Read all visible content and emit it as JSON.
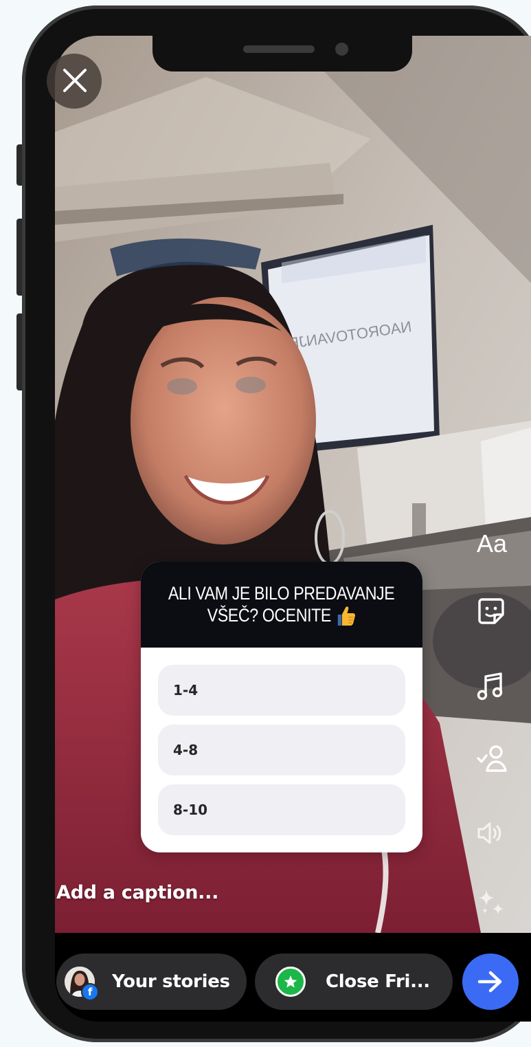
{
  "story_editor": {
    "close_icon": "close-icon",
    "tools": {
      "text_label": "Aa",
      "icons": [
        "sticker-icon",
        "music-note-icon",
        "tag-person-icon",
        "speaker-icon",
        "sparkles-icon"
      ]
    },
    "poll": {
      "question_line1": "ALI VAM JE BILO PREDAVANJE",
      "question_line2": "VŠEČ? OCENITE",
      "question_emoji": "thumbs-up-icon",
      "options": [
        "1-4",
        "4-8",
        "8-10"
      ]
    },
    "caption_placeholder": "Add a caption...",
    "share": {
      "your_stories": "Your stories",
      "close_friends": "Close Fri...",
      "send_icon": "arrow-right-icon"
    }
  },
  "colors": {
    "poll_header": "#0b0d12",
    "option_bg": "#efeff4",
    "send_button": "#3b6bf5",
    "close_friends_badge": "#1bb749",
    "facebook_badge": "#1877f2",
    "pill_bg": "#2c2c2e"
  }
}
